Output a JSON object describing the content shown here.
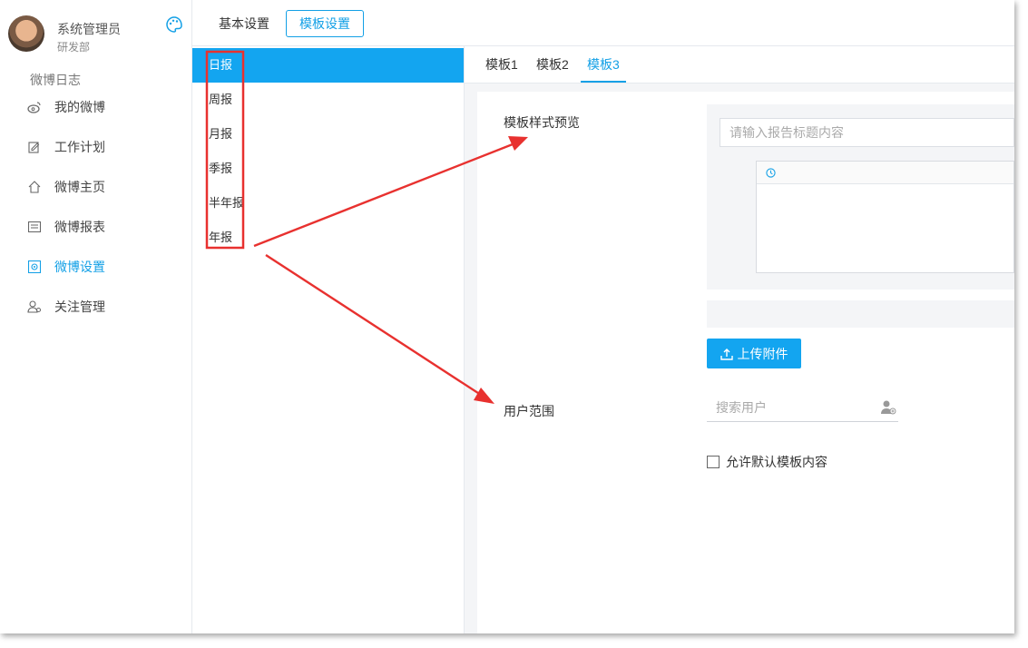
{
  "user": {
    "name": "系统管理员",
    "department": "研发部"
  },
  "sidebar": {
    "section_title": "微博日志",
    "items": [
      {
        "label": "我的微博",
        "icon": "weibo-icon"
      },
      {
        "label": "工作计划",
        "icon": "edit-icon"
      },
      {
        "label": "微博主页",
        "icon": "home-icon"
      },
      {
        "label": "微博报表",
        "icon": "report-icon"
      },
      {
        "label": "微博设置",
        "icon": "settings-icon",
        "active": true
      },
      {
        "label": "关注管理",
        "icon": "follow-user-icon"
      }
    ]
  },
  "top_tabs": [
    {
      "label": "基本设置"
    },
    {
      "label": "模板设置",
      "active": true
    }
  ],
  "report_types": [
    {
      "label": "日报",
      "active": true
    },
    {
      "label": "周报"
    },
    {
      "label": "月报"
    },
    {
      "label": "季报"
    },
    {
      "label": "半年报"
    },
    {
      "label": "年报"
    }
  ],
  "template_tabs": [
    {
      "label": "模板1"
    },
    {
      "label": "模板2"
    },
    {
      "label": "模板3",
      "active": true
    }
  ],
  "form": {
    "preview_label": "模板样式预览",
    "title_placeholder": "请输入报告标题内容",
    "upload_label": "上传附件",
    "user_scope_label": "用户范围",
    "search_placeholder": "搜索用户",
    "allow_default_label": "允许默认模板内容"
  },
  "colors": {
    "accent": "#13a5f0",
    "annotation_red": "#e8312f"
  }
}
